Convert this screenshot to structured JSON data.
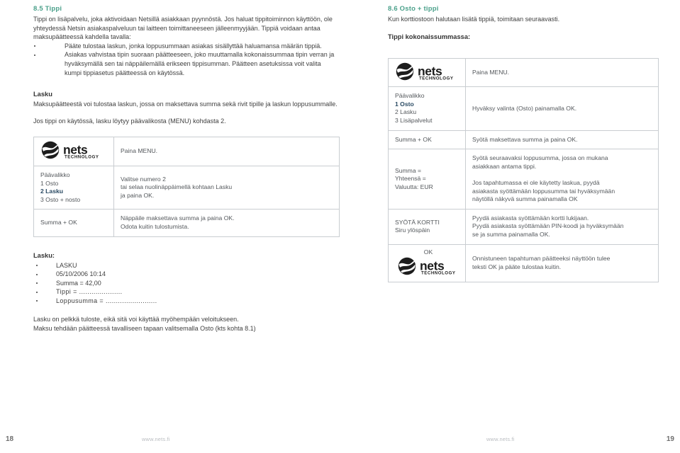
{
  "left": {
    "section": {
      "heading": "8.5 Tippi",
      "intro": "Tippi on lisäpalvelu, joka aktivoidaan Netsillä asiakkaan pyynnöstä. Jos haluat tippitoiminnon käyttöön, ole yhteydessä Netsin asiakaspalveluun tai laitteen toimittaneeseen jälleenmyyjään. Tippiä voidaan antaa maksupäätteessä kahdella tavalla:",
      "bullets": [
        "Pääte tulostaa laskun, jonka loppusummaan asiakas sisällyttää haluamansa määrän tippiä.",
        "Asiakas vahvistaa tipin suoraan päätteeseen, joko muuttamalla kokonaissummaa tipin verran ja hyväksymällä sen tai näppäilemällä erikseen tippisumman. Päätteen asetuksissa voit valita kumpi tippiasetus päätteessä on käytössä."
      ]
    },
    "lasku": {
      "heading": "Lasku",
      "paragraph": "Maksupäätteestä voi tulostaa laskun, jossa on maksettava summa sekä rivit tipille ja laskun loppusummalle.",
      "note": "Jos tippi on käytössä, lasku löytyy päävalikosta (MENU) kohdasta 2."
    },
    "table": {
      "rows": [
        {
          "key_logo": true,
          "key_lines": [],
          "value_lines": [
            "Paina MENU."
          ]
        },
        {
          "key_logo": false,
          "key_lines": [
            {
              "text": "Päävalikko",
              "highlight": false
            },
            {
              "text": "1 Osto",
              "highlight": false
            },
            {
              "text": "2 Lasku",
              "highlight": true
            },
            {
              "text": "3 Osto + nosto",
              "highlight": false
            }
          ],
          "value_lines": [
            "Valitse numero 2",
            "tai selaa nuolinäppäimellä kohtaan Lasku",
            "ja paina OK."
          ]
        },
        {
          "key_logo": false,
          "key_lines": [
            {
              "text": "Summa + OK",
              "highlight": false
            }
          ],
          "value_lines": [
            "Näppäile maksettava summa ja paina OK.",
            "Odota kuitin tulostumista."
          ]
        }
      ]
    },
    "receipt": {
      "heading": "Lasku:",
      "items": [
        "LASKU",
        "05/10/2006 10:14",
        "Summa = 42,00",
        "Tippi = .....................",
        "Loppusumma = ........................."
      ]
    },
    "closing": [
      "Lasku on pelkkä tuloste, eikä sitä voi käyttää myöhempään veloitukseen.",
      "Maksu tehdään päätteessä tavalliseen tapaan valitsemalla Osto (kts kohta 8.1)"
    ]
  },
  "right": {
    "section": {
      "heading": "8.6 Osto + tippi",
      "intro": "Kun korttiostoon halutaan lisätä tippiä, toimitaan seuraavasti.",
      "subheading": "Tippi kokonaissummassa:"
    },
    "table": {
      "rows": [
        {
          "key_logo": true,
          "key_lines": [],
          "value_lines": [
            "Paina MENU."
          ]
        },
        {
          "key_logo": false,
          "key_lines": [
            {
              "text": "Päävalikko",
              "highlight": false
            },
            {
              "text": "1 Osto",
              "highlight": true
            },
            {
              "text": "2 Lasku",
              "highlight": false
            },
            {
              "text": "3 Lisäpalvelut",
              "highlight": false
            }
          ],
          "value_lines": [
            "Hyväksy valinta (Osto) painamalla OK."
          ]
        },
        {
          "key_logo": false,
          "key_lines": [
            {
              "text": "Summa + OK",
              "highlight": false
            }
          ],
          "value_lines": [
            "Syötä maksettava summa ja paina OK."
          ]
        },
        {
          "key_logo": false,
          "key_lines": [
            {
              "text": "Summa =",
              "highlight": false
            },
            {
              "text": "Yhteensä =",
              "highlight": false
            },
            {
              "text": "Valuutta: EUR",
              "highlight": false
            }
          ],
          "value_lines": [
            "Syötä seuraavaksi loppusumma, jossa on mukana",
            "asiakkaan antama tippi.",
            "",
            "Jos tapahtumassa ei ole käytetty laskua, pyydä",
            "asiakasta syöttämään loppusumma tai hyväksymään",
            "näytöllä näkyvä summa painamalla OK"
          ]
        },
        {
          "key_logo": false,
          "key_lines": [
            {
              "text": "SYÖTÄ KORTTI",
              "highlight": false
            },
            {
              "text": "Siru ylöspäin",
              "highlight": false
            }
          ],
          "value_lines": [
            "Pyydä asiakasta syöttämään kortti lukijaan.",
            "Pyydä asiakasta syöttämään PIN-koodi ja hyväksymään",
            "se ja summa painamalla OK."
          ]
        },
        {
          "key_logo": true,
          "key_lines": [
            {
              "text": "OK",
              "highlight": false
            }
          ],
          "value_lines": [
            "Onnistuneen tapahtuman päätteeksi näyttöön tulee",
            "teksti OK ja pääte tulostaa kuitin."
          ]
        }
      ]
    }
  },
  "logo": {
    "wordmark": "nets",
    "tagline": "TECHNOLOGY"
  },
  "footer": {
    "page_left": "18",
    "page_right": "19",
    "url_left": "www.nets.fi",
    "url_right": "www.nets.fi"
  },
  "colors": {
    "heading_green": "#4aa08a",
    "highlight_blue": "#2a4a63",
    "body_gray": "#3f3f3f",
    "table_border": "#c9cdd1"
  }
}
